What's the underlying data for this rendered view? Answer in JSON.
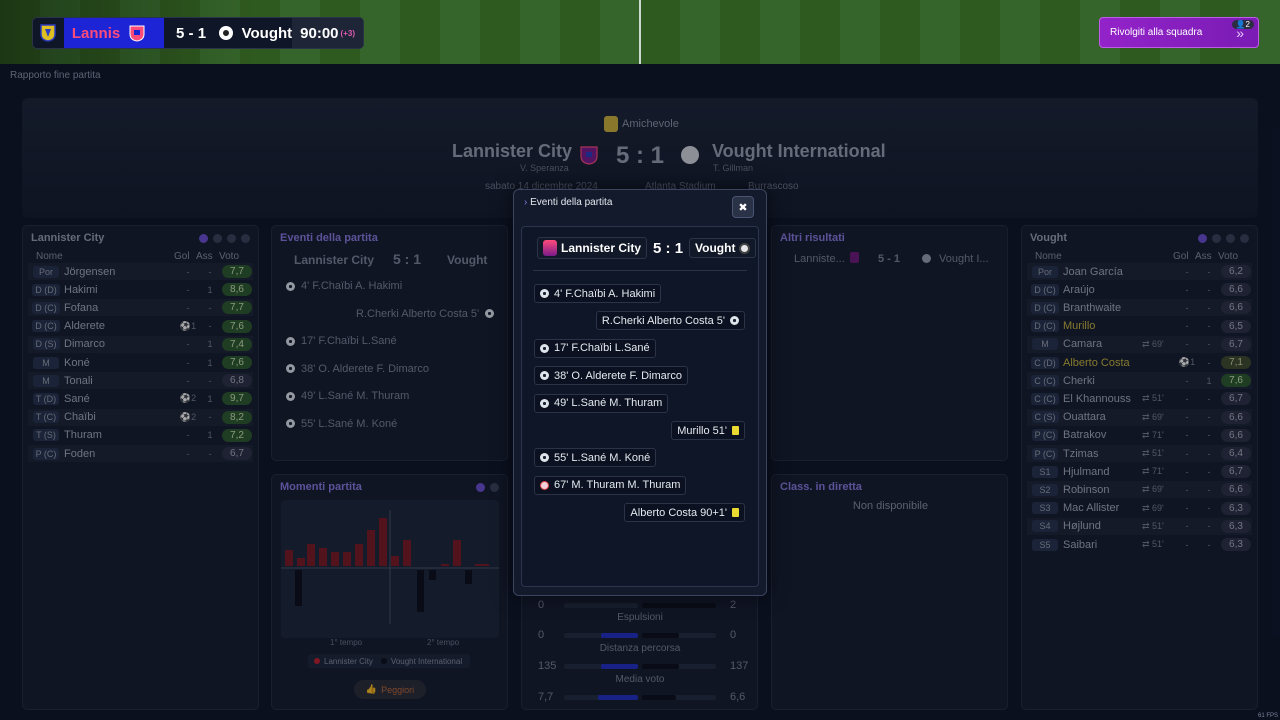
{
  "scorebug": {
    "home": "Lannis",
    "score": "5 - 1",
    "away": "Vought",
    "clock": "90:00",
    "added": "(+3)"
  },
  "team_talk": {
    "label": "Rivolgiti alla squadra",
    "badge": "2",
    "icon": "chevron-double-right-icon"
  },
  "breadcrumb": "Rapporto fine partita",
  "header": {
    "competition": "Amichevole",
    "home_team": "Lannister City",
    "home_coach": "V. Speranza",
    "score": "5 : 1",
    "away_team": "Vought International",
    "away_coach": "T. Gillman",
    "date": "sabato 14 dicembre 2024",
    "stadium": "Atlanta Stadium",
    "weather": "Burrascoso"
  },
  "home_lineup": {
    "title": "Lannister City",
    "cols": {
      "name": "Nome",
      "goals": "Gol",
      "assists": "Ass",
      "rating": "Voto"
    },
    "rows": [
      {
        "pos": "Por",
        "name": "Jörgensen",
        "gol": "-",
        "ass": "-",
        "voto": "7,7",
        "tone": "g"
      },
      {
        "pos": "D (D)",
        "name": "Hakimi",
        "gol": "-",
        "ass": "1",
        "voto": "8,6",
        "tone": "g"
      },
      {
        "pos": "D (C)",
        "name": "Fofana",
        "gol": "-",
        "ass": "-",
        "voto": "7,7",
        "tone": "g"
      },
      {
        "pos": "D (C)",
        "name": "Alderete",
        "gol": "⚽1",
        "ass": "-",
        "voto": "7,6",
        "tone": "g"
      },
      {
        "pos": "D (S)",
        "name": "Dimarco",
        "gol": "-",
        "ass": "1",
        "voto": "7,4",
        "tone": "g"
      },
      {
        "pos": "M",
        "name": "Koné",
        "gol": "-",
        "ass": "1",
        "voto": "7,6",
        "tone": "g"
      },
      {
        "pos": "M",
        "name": "Tonali",
        "gol": "-",
        "ass": "-",
        "voto": "6,8",
        "tone": "n"
      },
      {
        "pos": "T (D)",
        "name": "Sané",
        "gol": "⚽2",
        "ass": "1",
        "voto": "9,7",
        "tone": "g"
      },
      {
        "pos": "T (C)",
        "name": "Chaïbi",
        "gol": "⚽2",
        "ass": "-",
        "voto": "8,2",
        "tone": "g"
      },
      {
        "pos": "T (S)",
        "name": "Thuram",
        "gol": "-",
        "ass": "1",
        "voto": "7,2",
        "tone": "g"
      },
      {
        "pos": "P (C)",
        "name": "Foden",
        "gol": "-",
        "ass": "-",
        "voto": "6,7",
        "tone": "n"
      }
    ]
  },
  "away_lineup": {
    "title": "Vought",
    "cols": {
      "name": "Nome",
      "goals": "Gol",
      "assists": "Ass",
      "rating": "Voto"
    },
    "rows": [
      {
        "pos": "Por",
        "name": "Joan García",
        "sub": "",
        "gol": "-",
        "ass": "-",
        "voto": "6,2",
        "tone": "n"
      },
      {
        "pos": "D (C)",
        "name": "Araújo",
        "sub": "",
        "gol": "-",
        "ass": "-",
        "voto": "6,6",
        "tone": "n"
      },
      {
        "pos": "D (C)",
        "name": "Branthwaite",
        "sub": "",
        "gol": "-",
        "ass": "-",
        "voto": "6,6",
        "tone": "n"
      },
      {
        "pos": "D (C)",
        "name": "Murillo",
        "sub": "",
        "gol": "-",
        "ass": "-",
        "voto": "6,5",
        "tone": "n",
        "yellow": true
      },
      {
        "pos": "M",
        "name": "Camara",
        "sub": "⇄ 69'",
        "gol": "-",
        "ass": "-",
        "voto": "6,7",
        "tone": "n"
      },
      {
        "pos": "C (D)",
        "name": "Alberto Costa",
        "sub": "",
        "gol": "⚽1",
        "ass": "-",
        "voto": "7,1",
        "tone": "lg",
        "yellow": true
      },
      {
        "pos": "C (C)",
        "name": "Cherki",
        "sub": "",
        "gol": "-",
        "ass": "1",
        "voto": "7,6",
        "tone": "g"
      },
      {
        "pos": "C (C)",
        "name": "El Khannouss",
        "sub": "⇄ 51'",
        "gol": "-",
        "ass": "-",
        "voto": "6,7",
        "tone": "n"
      },
      {
        "pos": "C (S)",
        "name": "Ouattara",
        "sub": "⇄ 69'",
        "gol": "-",
        "ass": "-",
        "voto": "6,6",
        "tone": "n"
      },
      {
        "pos": "P (C)",
        "name": "Batrakov",
        "sub": "⇄ 71'",
        "gol": "-",
        "ass": "-",
        "voto": "6,6",
        "tone": "n"
      },
      {
        "pos": "P (C)",
        "name": "Tzimas",
        "sub": "⇄ 51'",
        "gol": "-",
        "ass": "-",
        "voto": "6,4",
        "tone": "n"
      },
      {
        "pos": "S1",
        "name": "Hjulmand",
        "sub": "⇄ 71'",
        "gol": "-",
        "ass": "-",
        "voto": "6,7",
        "tone": "n"
      },
      {
        "pos": "S2",
        "name": "Robinson",
        "sub": "⇄ 69'",
        "gol": "-",
        "ass": "-",
        "voto": "6,6",
        "tone": "n"
      },
      {
        "pos": "S3",
        "name": "Mac Allister",
        "sub": "⇄ 69'",
        "gol": "-",
        "ass": "-",
        "voto": "6,3",
        "tone": "n"
      },
      {
        "pos": "S4",
        "name": "Højlund",
        "sub": "⇄ 51'",
        "gol": "-",
        "ass": "-",
        "voto": "6,3",
        "tone": "n"
      },
      {
        "pos": "S5",
        "name": "Saibari",
        "sub": "⇄ 51'",
        "gol": "-",
        "ass": "-",
        "voto": "6,3",
        "tone": "n"
      }
    ]
  },
  "events_panel": {
    "title": "Eventi della partita",
    "home": "Lannister City",
    "score": "5 : 1",
    "away": "Vought",
    "events": [
      {
        "text": "4' F.Chaïbi A. Hakimi",
        "side": "home"
      },
      {
        "text": "R.Cherki Alberto Costa 5'",
        "side": "away"
      },
      {
        "text": "17' F.Chaïbi L.Sané",
        "side": "home"
      },
      {
        "text": "38' O. Alderete F. Dimarco",
        "side": "home"
      },
      {
        "text": "49' L.Sané M. Thuram",
        "side": "home"
      },
      {
        "text": "55' L.Sané M. Koné",
        "side": "home"
      }
    ]
  },
  "moments": {
    "title": "Momenti partita",
    "first_half": "1° tempo",
    "second_half": "2° tempo",
    "legend_home": "Lannister City",
    "legend_away": "Vought International",
    "button": "Peggiori"
  },
  "other_results": {
    "title": "Altri risultati",
    "home": "Lanniste...",
    "score": "5 - 1",
    "away": "Vought I..."
  },
  "live_table": {
    "title": "Class. in diretta",
    "message": "Non disponibile"
  },
  "stats": [
    {
      "label": "",
      "home": "0",
      "away": "2",
      "home_frac": 0.0,
      "away_frac": 1.0
    },
    {
      "label": "Espulsioni",
      "home": "0",
      "away": "0",
      "home_frac": 0.5,
      "away_frac": 0.5
    },
    {
      "label": "Distanza percorsa",
      "home": "135",
      "away": "137",
      "home_frac": 0.5,
      "away_frac": 0.5
    },
    {
      "label": "Media voto",
      "home": "7,7",
      "away": "6,6",
      "home_frac": 0.54,
      "away_frac": 0.46
    }
  ],
  "modal": {
    "title": "Eventi della partita",
    "close": "✖",
    "home": "Lannister City",
    "score": "5 : 1",
    "away": "Vought",
    "events": [
      {
        "text": "4' F.Chaïbi A. Hakimi",
        "side": "home",
        "kind": "goal"
      },
      {
        "text": "R.Cherki Alberto Costa 5'",
        "side": "away",
        "kind": "goal"
      },
      {
        "text": "17' F.Chaïbi L.Sané",
        "side": "home",
        "kind": "goal"
      },
      {
        "text": "38' O. Alderete F. Dimarco",
        "side": "home",
        "kind": "goal"
      },
      {
        "text": "49' L.Sané M. Thuram",
        "side": "home",
        "kind": "goal"
      },
      {
        "text": "Murillo 51'",
        "side": "away",
        "kind": "yellow"
      },
      {
        "text": "55' L.Sané M. Koné",
        "side": "home",
        "kind": "goal"
      },
      {
        "text": "67' M. Thuram M. Thuram",
        "side": "home",
        "kind": "own"
      },
      {
        "text": "Alberto Costa 90+1'",
        "side": "away",
        "kind": "yellow"
      }
    ]
  },
  "fps": "61 FPS",
  "colors": {
    "accent": "#6c4fd0",
    "home": "#1c24d6",
    "home_text": "#ff4b7a",
    "talk": "#9323c9",
    "rating_good": "#2d5a2a",
    "bars_home": "#7d1a22"
  }
}
